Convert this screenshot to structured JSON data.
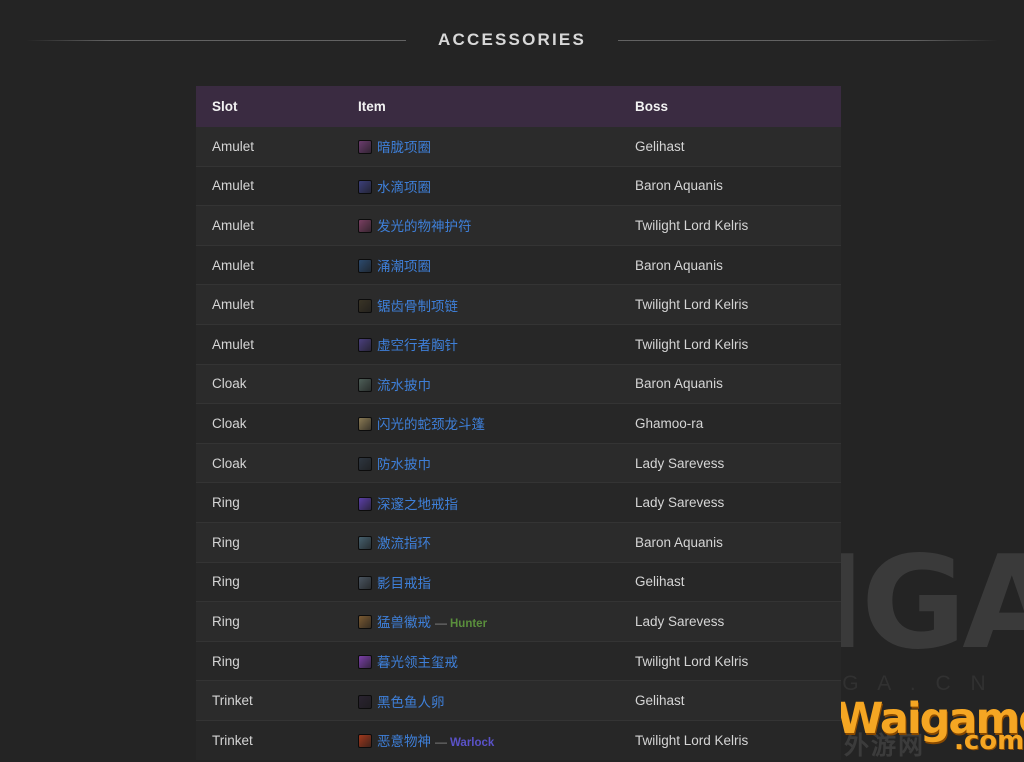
{
  "section": {
    "title": "ACCESSORIES"
  },
  "table": {
    "columns": [
      "Slot",
      "Item",
      "Boss"
    ],
    "rows": [
      {
        "slot": "Amulet",
        "item": "暗胧项圈",
        "icon": "#6b3c6e",
        "boss": "Gelihast",
        "spec": "",
        "spec_color": ""
      },
      {
        "slot": "Amulet",
        "item": "水滴项圈",
        "icon": "#3c3f7a",
        "boss": "Baron Aquanis",
        "spec": "",
        "spec_color": ""
      },
      {
        "slot": "Amulet",
        "item": "发光的物神护符",
        "icon": "#7a3f62",
        "boss": "Twilight Lord Kelris",
        "spec": "",
        "spec_color": ""
      },
      {
        "slot": "Amulet",
        "item": "涌潮项圈",
        "icon": "#2c4a6e",
        "boss": "Baron Aquanis",
        "spec": "",
        "spec_color": ""
      },
      {
        "slot": "Amulet",
        "item": "锯齿骨制项链",
        "icon": "#3a3426",
        "boss": "Twilight Lord Kelris",
        "spec": "",
        "spec_color": ""
      },
      {
        "slot": "Amulet",
        "item": "虚空行者胸针",
        "icon": "#4a3f7e",
        "boss": "Twilight Lord Kelris",
        "spec": "",
        "spec_color": ""
      },
      {
        "slot": "Cloak",
        "item": "流水披巾",
        "icon": "#4e5f58",
        "boss": "Baron Aquanis",
        "spec": "",
        "spec_color": ""
      },
      {
        "slot": "Cloak",
        "item": "闪光的蛇颈龙斗篷",
        "icon": "#8a7a54",
        "boss": "Ghamoo-ra",
        "spec": "",
        "spec_color": ""
      },
      {
        "slot": "Cloak",
        "item": "防水披巾",
        "icon": "#2e3640",
        "boss": "Lady Sarevess",
        "spec": "",
        "spec_color": ""
      },
      {
        "slot": "Ring",
        "item": "深邃之地戒指",
        "icon": "#5b3fa8",
        "boss": "Lady Sarevess",
        "spec": "",
        "spec_color": ""
      },
      {
        "slot": "Ring",
        "item": "激流指环",
        "icon": "#46606e",
        "boss": "Baron Aquanis",
        "spec": "",
        "spec_color": ""
      },
      {
        "slot": "Ring",
        "item": "影目戒指",
        "icon": "#4a5560",
        "boss": "Gelihast",
        "spec": "",
        "spec_color": ""
      },
      {
        "slot": "Ring",
        "item": "猛兽徽戒",
        "icon": "#7a5a32",
        "boss": "Lady Sarevess",
        "spec": "Hunter",
        "spec_color": "#5a8f3c"
      },
      {
        "slot": "Ring",
        "item": "暮光领主玺戒",
        "icon": "#7b3fa8",
        "boss": "Twilight Lord Kelris",
        "spec": "",
        "spec_color": ""
      },
      {
        "slot": "Trinket",
        "item": "黑色鱼人卵",
        "icon": "#2a2330",
        "boss": "Gelihast",
        "spec": "",
        "spec_color": ""
      },
      {
        "slot": "Trinket",
        "item": "恶意物神",
        "icon": "#a0381c",
        "boss": "Twilight Lord Kelris",
        "spec": "Warlock",
        "spec_color": "#5a52c8"
      }
    ]
  },
  "watermarks": {
    "nga": {
      "text": "NGA",
      "subtitle": "B B S . N G A . C N",
      "icon": "bear-paw-icon"
    },
    "waigamer": {
      "text": "Waigamer",
      ".com": ".com",
      "suffix": ".com",
      "chinese": "外游网"
    }
  }
}
